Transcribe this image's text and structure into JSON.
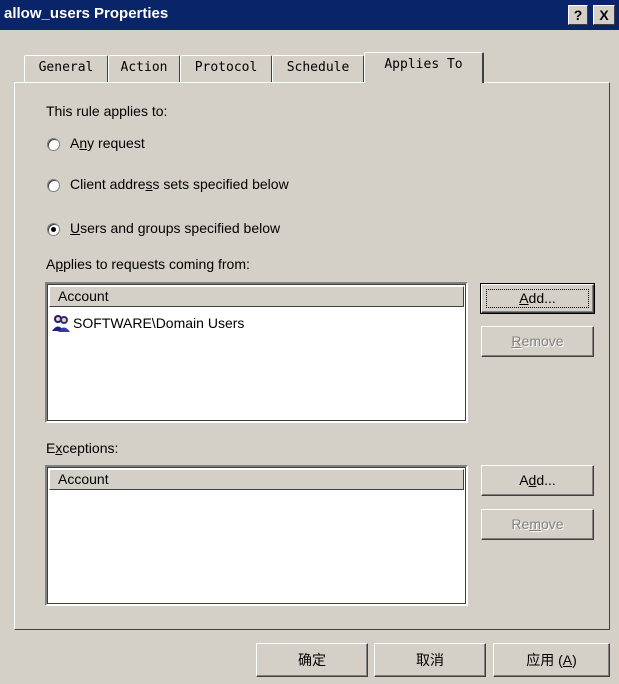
{
  "window": {
    "title": "allow_users Properties",
    "help_glyph": "?",
    "close_glyph": "X"
  },
  "tabs": [
    {
      "label": "General"
    },
    {
      "label": "Action"
    },
    {
      "label": "Protocol"
    },
    {
      "label": "Schedule"
    },
    {
      "label": "Applies To",
      "active": true
    }
  ],
  "applies_to": {
    "intro": "This rule applies to:",
    "options": [
      {
        "pre": "A",
        "mn": "n",
        "post": "y request",
        "selected": false
      },
      {
        "pre": "Client addre",
        "mn": "s",
        "post": "s sets specified below",
        "selected": false
      },
      {
        "pre": "",
        "mn": "U",
        "post": "sers and groups specified below",
        "selected": true
      }
    ],
    "requests_label": {
      "pre": "A",
      "mn": "p",
      "post": "plies to requests coming from:"
    },
    "requests_list": {
      "column": "Account",
      "rows": [
        {
          "text": "SOFTWARE\\Domain Users",
          "icon": "users-group-icon"
        }
      ]
    },
    "requests_buttons": {
      "add": {
        "pre": "",
        "mn": "A",
        "post": "dd..."
      },
      "remove": {
        "pre": "",
        "mn": "R",
        "post": "emove"
      }
    },
    "exceptions_label": {
      "pre": "E",
      "mn": "x",
      "post": "ceptions:"
    },
    "exceptions_list": {
      "column": "Account",
      "rows": []
    },
    "exceptions_buttons": {
      "add": {
        "pre": "A",
        "mn": "d",
        "post": "d..."
      },
      "remove": {
        "pre": "Re",
        "mn": "m",
        "post": "ove"
      }
    }
  },
  "footer": {
    "ok": "确定",
    "cancel": "取消",
    "apply": "应用 (",
    "apply_mn": "A",
    "apply_post": ")"
  },
  "colors": {
    "titlebar": "#0a246a",
    "face": "#d4d0c8",
    "disabled_text": "#808080"
  }
}
